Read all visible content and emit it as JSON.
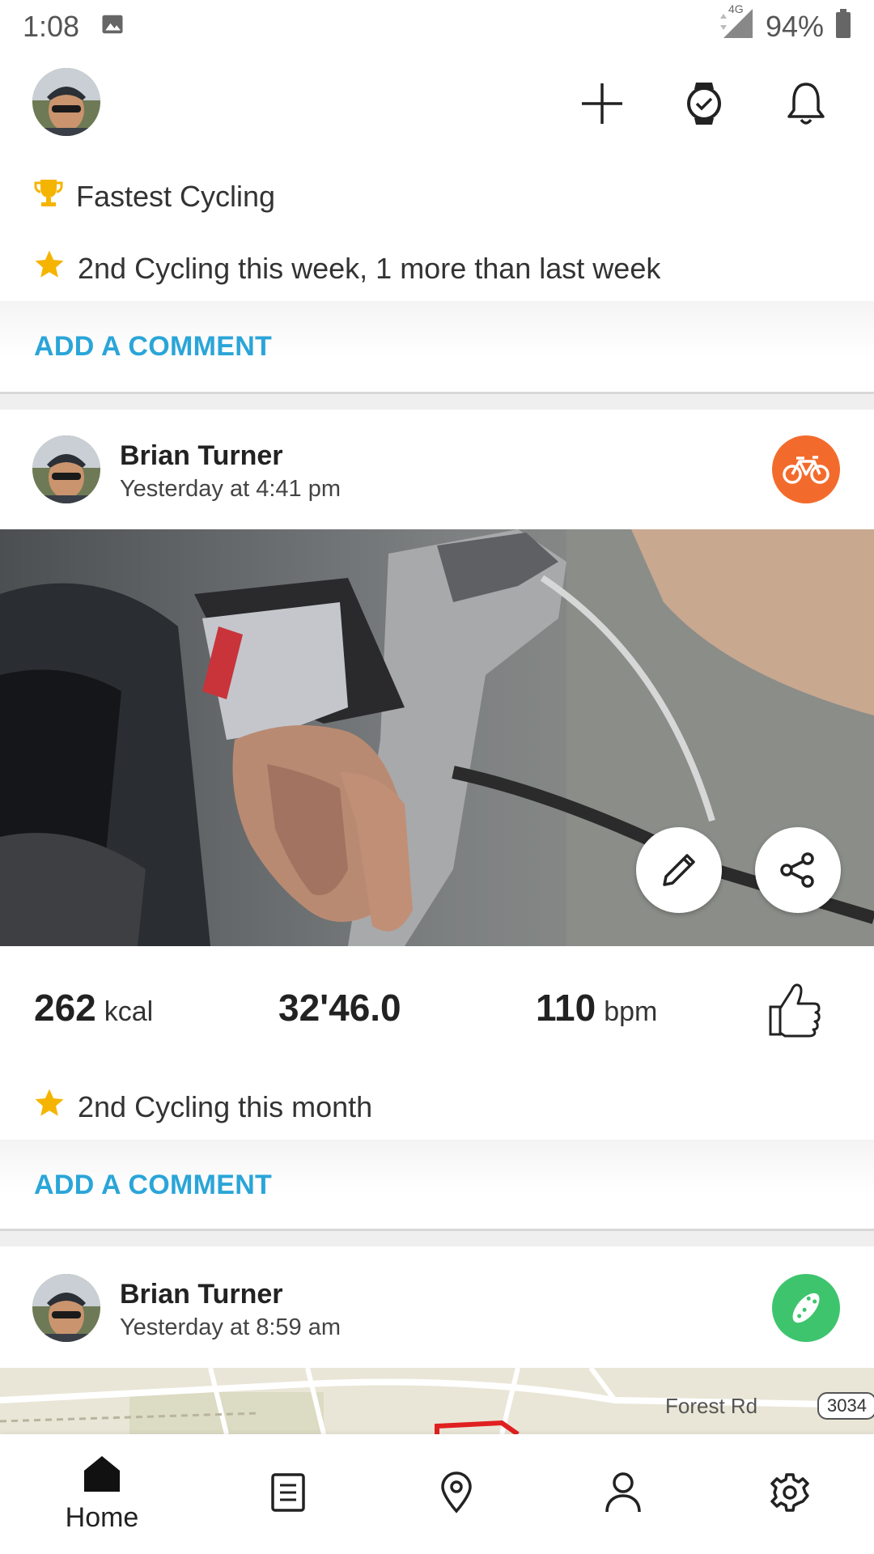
{
  "status": {
    "time": "1:08",
    "network": "4G",
    "battery": "94%"
  },
  "header": {
    "actions": [
      "add-icon",
      "watch-icon",
      "bell-icon"
    ]
  },
  "prev_post": {
    "achievements": [
      {
        "icon": "trophy-icon",
        "text": "Fastest Cycling"
      },
      {
        "icon": "star-icon",
        "text": "2nd Cycling this week, 1 more than last week"
      }
    ],
    "comment_label": "ADD A COMMENT"
  },
  "post1": {
    "user": "Brian Turner",
    "time": "Yesterday at 4:41 pm",
    "sport_icon": "bike-icon",
    "sport_color": "#f36b2c",
    "stats": {
      "kcal_value": "262",
      "kcal_unit": "kcal",
      "duration": "32'46.0",
      "hr_value": "110",
      "hr_unit": "bpm"
    },
    "achievement": "2nd Cycling this month",
    "comment_label": "ADD A COMMENT"
  },
  "post2": {
    "user": "Brian Turner",
    "time": "Yesterday at 8:59 am",
    "sport_icon": "running-shoe-icon",
    "sport_color": "#3ec46d",
    "map_labels": {
      "road": "Forest Rd",
      "route_badge": "3034"
    }
  },
  "nav": {
    "home_label": "Home"
  },
  "colors": {
    "accent": "#2aa5d8",
    "star": "#f5b400",
    "route": "#e02020"
  }
}
